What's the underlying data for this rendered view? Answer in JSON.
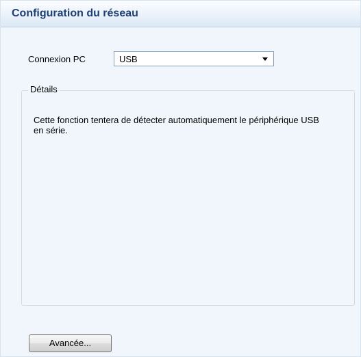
{
  "header": {
    "title": "Configuration du réseau"
  },
  "connection": {
    "label": "Connexion PC",
    "selected": "USB"
  },
  "details": {
    "legend": "Détails",
    "text": "Cette fonction tentera de détecter automatiquement le périphérique USB en série."
  },
  "buttons": {
    "advanced_label": "Avancée..."
  },
  "colors": {
    "header_text": "#1c3f78",
    "panel_background": "#f0f6fb",
    "header_gradient_bottom": "#dce8f5"
  }
}
